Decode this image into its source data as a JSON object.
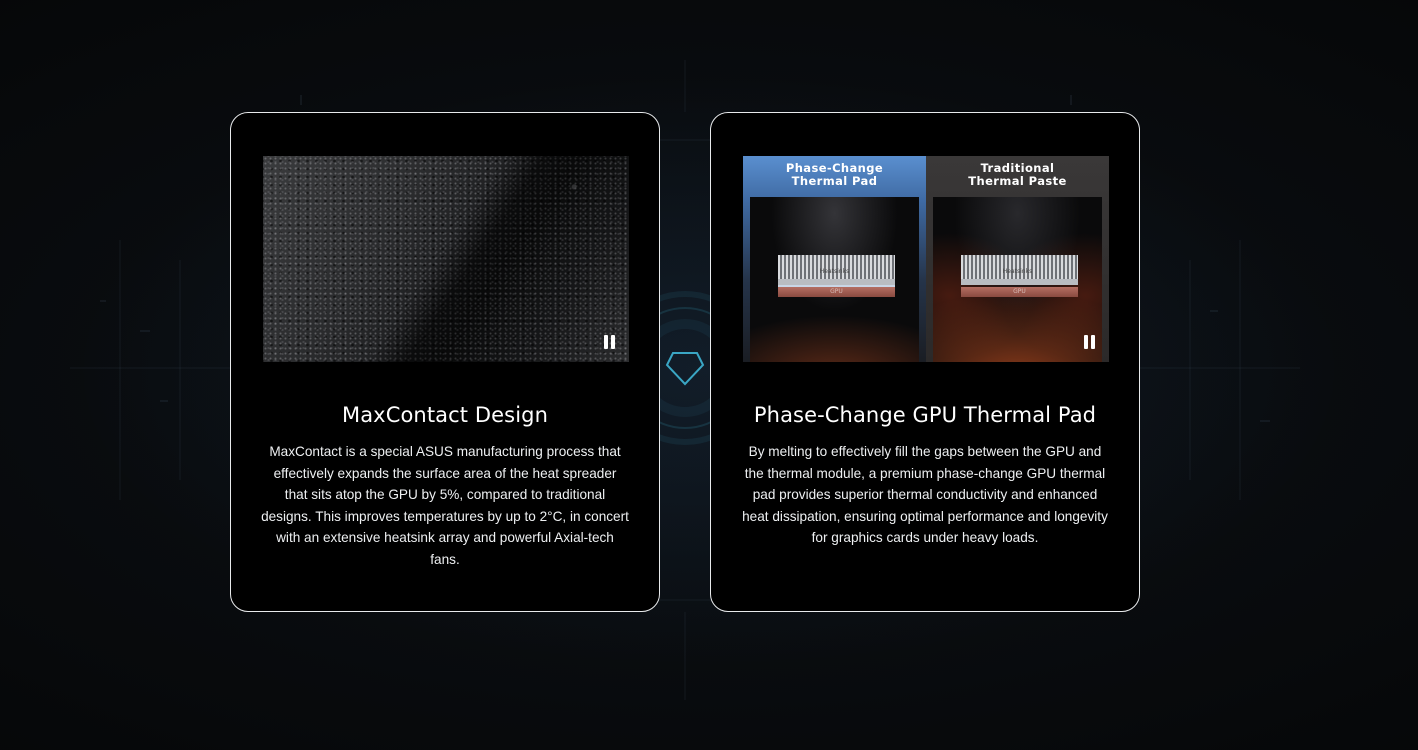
{
  "cards": [
    {
      "title": "MaxContact Design",
      "body": "MaxContact is a special ASUS manufacturing process that effectively expands the surface area of the heat spreader that sits atop the GPU by 5%, compared to traditional designs. This improves temperatures by up to 2°C, in concert with an extensive heatsink array and powerful Axial-tech fans.",
      "media": {
        "control": "pause-icon"
      }
    },
    {
      "title": "Phase-Change GPU Thermal Pad",
      "body": "By melting to effectively fill the gaps between the GPU and the thermal module, a premium phase-change GPU thermal pad provides superior thermal conductivity and enhanced heat dissipation, ensuring optimal performance and longevity for graphics cards under heavy loads.",
      "media": {
        "left_label": "Phase-Change\nThermal Pad",
        "right_label": "Traditional\nThermal Paste",
        "heatsink_label": "Heatsinks",
        "gpu_label": "GPU",
        "control": "pause-icon"
      }
    }
  ],
  "colors": {
    "background": "#070809",
    "card_border": "#e8eaec",
    "accent_blue": "#5a8fcf",
    "hex_accent": "#3aa6c4"
  }
}
